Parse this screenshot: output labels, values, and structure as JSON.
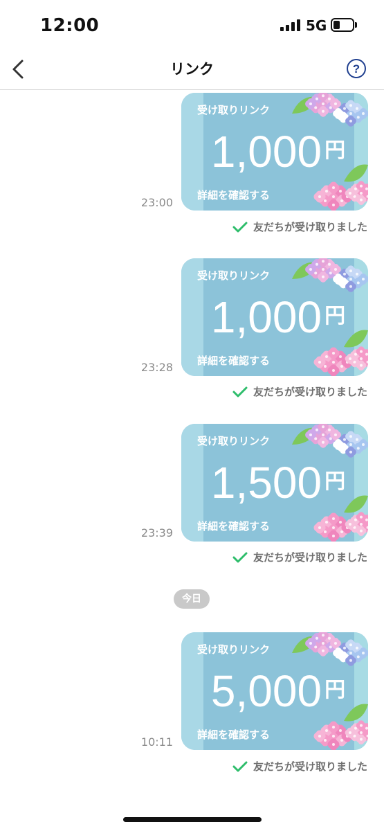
{
  "status_bar": {
    "time": "12:00",
    "network": "5G"
  },
  "nav": {
    "title": "リンク"
  },
  "messages": [
    {
      "time": "23:00",
      "label": "受け取りリンク",
      "amount": "1,000",
      "currency": "円",
      "detail": "詳細を確認する",
      "receipt": "友だちが受け取りました"
    },
    {
      "time": "23:28",
      "label": "受け取りリンク",
      "amount": "1,000",
      "currency": "円",
      "detail": "詳細を確認する",
      "receipt": "友だちが受け取りました"
    },
    {
      "time": "23:39",
      "label": "受け取りリンク",
      "amount": "1,500",
      "currency": "円",
      "detail": "詳細を確認する",
      "receipt": "友だちが受け取りました"
    },
    {
      "time": "10:11",
      "label": "受け取りリンク",
      "amount": "5,000",
      "currency": "円",
      "detail": "詳細を確認する",
      "receipt": "友だちが受け取りました"
    }
  ],
  "date_separator": "今日",
  "colors": {
    "card": "#8cc3d9",
    "check": "#2ebd6b",
    "pill": "#c9c9c9"
  }
}
